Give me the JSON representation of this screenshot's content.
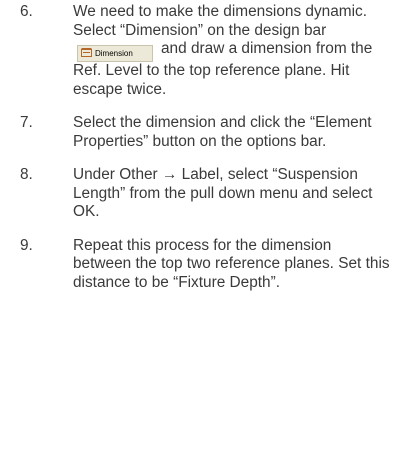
{
  "steps": [
    {
      "number": "6.",
      "text_before": "We need to make the dimensions dynamic. Select “Dimension” on the design bar",
      "button": {
        "label": "Dimension",
        "icon": "dimension-icon",
        "bg_color": "#ece9d8",
        "icon_color": "#b5672a"
      },
      "text_after": "and draw a dimension from the Ref. Level to the top reference plane. Hit escape twice."
    },
    {
      "number": "7.",
      "text": "Select the dimension and click the “Element Properties” button on the options bar."
    },
    {
      "number": "8.",
      "text": "Under Other → Label, select “Suspension Length” from the pull down menu and select OK."
    },
    {
      "number": "9.",
      "text": "Repeat this process for the dimension between the top two reference planes. Set this distance to be “Fixture Depth”."
    }
  ]
}
